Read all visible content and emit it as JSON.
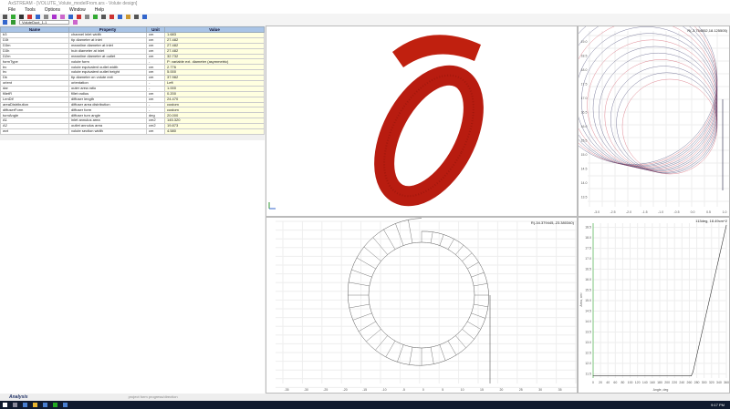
{
  "window": {
    "title": "AxSTREAM - [VOLUTE_Volute_modelFrom.ars - Volute design]"
  },
  "menu": [
    "File",
    "Tools",
    "Options",
    "Window",
    "Help"
  ],
  "toolbar2": {
    "combo_value": "VoluteDuct_1-1"
  },
  "table": {
    "headers": [
      "Name",
      "Property",
      "Unit",
      "Value"
    ],
    "rows": [
      [
        "b3",
        "channel inlet width",
        "cm",
        "1.683"
      ],
      [
        "D3t",
        "tip diameter at inlet",
        "cm",
        "27.482"
      ],
      [
        "D3m",
        "meanline diameter at inlet",
        "cm",
        "27.482"
      ],
      [
        "D3h",
        "hub diameter at inlet",
        "cm",
        "27.482"
      ],
      [
        "D2m",
        "meanline diameter at outlet",
        "cm",
        "32.732"
      ],
      [
        "formType",
        "volute form",
        "-",
        "P: variable ext. diameter (asymmetric)"
      ],
      [
        "bv",
        "volute equivalent outlet width",
        "cm",
        "2.776"
      ],
      [
        "hv",
        "volute equivalent outlet height",
        "cm",
        "5.000"
      ],
      [
        "Dk",
        "tip diameter on volute exit",
        "cm",
        "37.982"
      ],
      [
        "orient",
        "orientation",
        "-",
        "Left"
      ],
      [
        "dar",
        "outer area ratio",
        "-",
        "1.000"
      ],
      [
        "filletR",
        "fillet radius",
        "cm",
        "0.200"
      ],
      [
        "LenDif",
        "diffuser length",
        "cm",
        "24.470"
      ],
      [
        "areaDistribution",
        "diffuser area distribution",
        "-",
        "custom"
      ],
      [
        "diffuserForm",
        "diffuser form",
        "-",
        "custom"
      ],
      [
        "turnAngle",
        "diffuser turn angle",
        "deg",
        "20.000"
      ],
      [
        "A1",
        "inlet annulus area",
        "cm2",
        "145.320"
      ],
      [
        "A2",
        "outlet annulus area",
        "cm2",
        "19.873"
      ],
      [
        "wvt",
        "volute section width",
        "cm",
        "4.580"
      ]
    ]
  },
  "view3d": {
    "color": "#b81c10"
  },
  "sections_plot": {
    "readout": "R(-3.754552,18.125505)",
    "x_ticks": [
      "-3.0",
      "-2.5",
      "-2.0",
      "-1.5",
      "-1.0",
      "-0.5",
      "0.0",
      "0.5",
      "1.0"
    ],
    "y_ticks": [
      "19.0",
      "18.5",
      "18.0",
      "17.5",
      "17.0",
      "16.5",
      "16.0",
      "15.5",
      "15.0",
      "14.5",
      "14.0",
      "13.5"
    ]
  },
  "plan_plot": {
    "readout": "R(-34.379445,-23.380340)",
    "x_ticks": [
      "-35",
      "-30",
      "-25",
      "-20",
      "-15",
      "-10",
      "-5",
      "0",
      "5",
      "10",
      "15",
      "20",
      "25",
      "30",
      "35"
    ]
  },
  "chart_data": {
    "type": "line",
    "xlabel": "Angle, deg",
    "ylabel": "Area, cm²",
    "readout": "113deg, 18.49cm^2",
    "x_ticks": [
      "0",
      "20",
      "40",
      "60",
      "80",
      "100",
      "120",
      "140",
      "160",
      "180",
      "200",
      "220",
      "240",
      "260",
      "280",
      "300",
      "320",
      "340",
      "360"
    ],
    "y_ticks": [
      "18.5",
      "18.0",
      "17.5",
      "17.0",
      "16.5",
      "16.0",
      "15.5",
      "15.0",
      "14.5",
      "14.0",
      "13.5",
      "13.0",
      "12.5",
      "12.0",
      "11.5"
    ],
    "xlim": [
      0,
      360
    ],
    "ylim": [
      11.3,
      18.7
    ],
    "grid": true,
    "x": [
      0,
      265,
      270,
      360
    ],
    "y": [
      11.4,
      11.4,
      11.6,
      18.6
    ]
  },
  "status": {
    "tab": "Analysis",
    "text": "project form progress/direction"
  },
  "taskbar": {
    "clock": "9:17 PM"
  }
}
